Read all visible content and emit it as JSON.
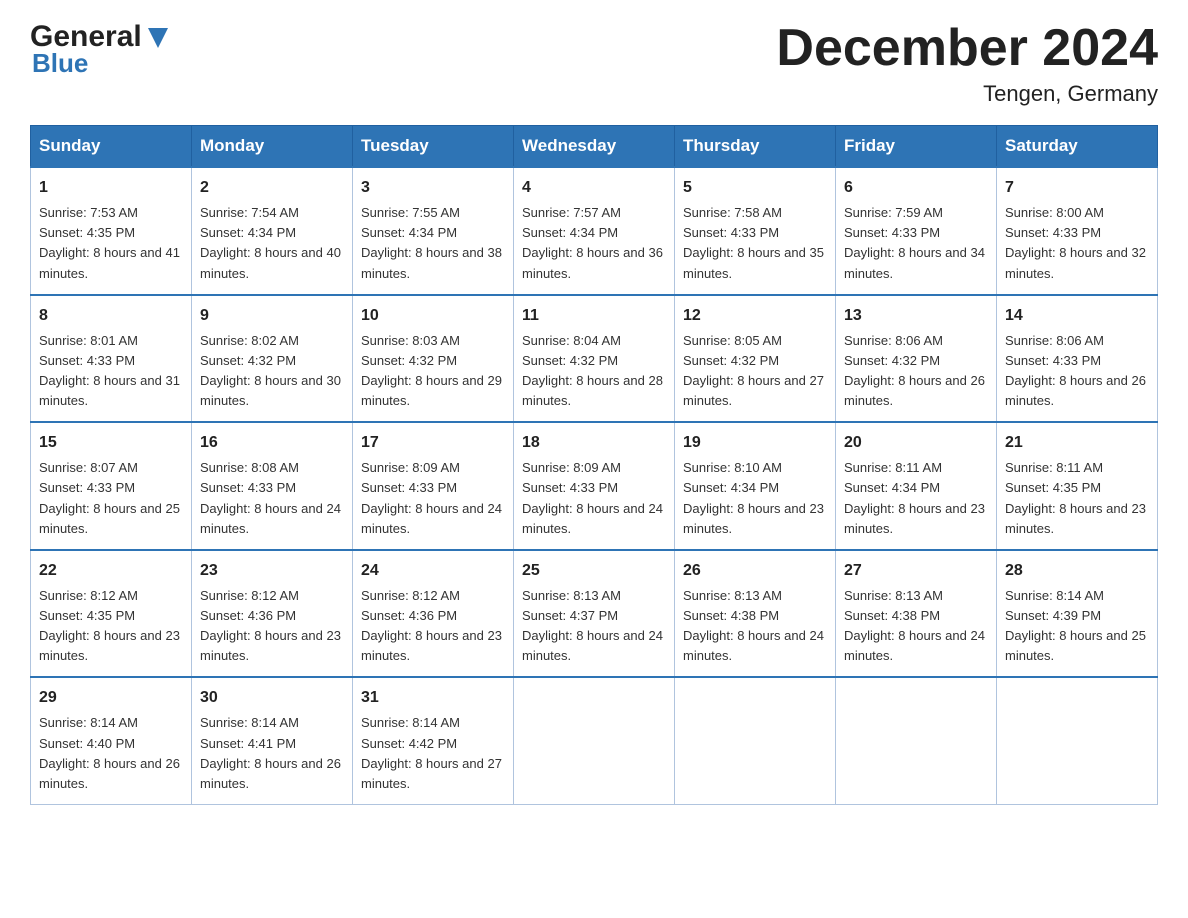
{
  "header": {
    "logo_general": "General",
    "logo_blue": "Blue",
    "title": "December 2024",
    "location": "Tengen, Germany"
  },
  "days_of_week": [
    "Sunday",
    "Monday",
    "Tuesday",
    "Wednesday",
    "Thursday",
    "Friday",
    "Saturday"
  ],
  "weeks": [
    [
      {
        "day": "1",
        "sunrise": "7:53 AM",
        "sunset": "4:35 PM",
        "daylight": "8 hours and 41 minutes."
      },
      {
        "day": "2",
        "sunrise": "7:54 AM",
        "sunset": "4:34 PM",
        "daylight": "8 hours and 40 minutes."
      },
      {
        "day": "3",
        "sunrise": "7:55 AM",
        "sunset": "4:34 PM",
        "daylight": "8 hours and 38 minutes."
      },
      {
        "day": "4",
        "sunrise": "7:57 AM",
        "sunset": "4:34 PM",
        "daylight": "8 hours and 36 minutes."
      },
      {
        "day": "5",
        "sunrise": "7:58 AM",
        "sunset": "4:33 PM",
        "daylight": "8 hours and 35 minutes."
      },
      {
        "day": "6",
        "sunrise": "7:59 AM",
        "sunset": "4:33 PM",
        "daylight": "8 hours and 34 minutes."
      },
      {
        "day": "7",
        "sunrise": "8:00 AM",
        "sunset": "4:33 PM",
        "daylight": "8 hours and 32 minutes."
      }
    ],
    [
      {
        "day": "8",
        "sunrise": "8:01 AM",
        "sunset": "4:33 PM",
        "daylight": "8 hours and 31 minutes."
      },
      {
        "day": "9",
        "sunrise": "8:02 AM",
        "sunset": "4:32 PM",
        "daylight": "8 hours and 30 minutes."
      },
      {
        "day": "10",
        "sunrise": "8:03 AM",
        "sunset": "4:32 PM",
        "daylight": "8 hours and 29 minutes."
      },
      {
        "day": "11",
        "sunrise": "8:04 AM",
        "sunset": "4:32 PM",
        "daylight": "8 hours and 28 minutes."
      },
      {
        "day": "12",
        "sunrise": "8:05 AM",
        "sunset": "4:32 PM",
        "daylight": "8 hours and 27 minutes."
      },
      {
        "day": "13",
        "sunrise": "8:06 AM",
        "sunset": "4:32 PM",
        "daylight": "8 hours and 26 minutes."
      },
      {
        "day": "14",
        "sunrise": "8:06 AM",
        "sunset": "4:33 PM",
        "daylight": "8 hours and 26 minutes."
      }
    ],
    [
      {
        "day": "15",
        "sunrise": "8:07 AM",
        "sunset": "4:33 PM",
        "daylight": "8 hours and 25 minutes."
      },
      {
        "day": "16",
        "sunrise": "8:08 AM",
        "sunset": "4:33 PM",
        "daylight": "8 hours and 24 minutes."
      },
      {
        "day": "17",
        "sunrise": "8:09 AM",
        "sunset": "4:33 PM",
        "daylight": "8 hours and 24 minutes."
      },
      {
        "day": "18",
        "sunrise": "8:09 AM",
        "sunset": "4:33 PM",
        "daylight": "8 hours and 24 minutes."
      },
      {
        "day": "19",
        "sunrise": "8:10 AM",
        "sunset": "4:34 PM",
        "daylight": "8 hours and 23 minutes."
      },
      {
        "day": "20",
        "sunrise": "8:11 AM",
        "sunset": "4:34 PM",
        "daylight": "8 hours and 23 minutes."
      },
      {
        "day": "21",
        "sunrise": "8:11 AM",
        "sunset": "4:35 PM",
        "daylight": "8 hours and 23 minutes."
      }
    ],
    [
      {
        "day": "22",
        "sunrise": "8:12 AM",
        "sunset": "4:35 PM",
        "daylight": "8 hours and 23 minutes."
      },
      {
        "day": "23",
        "sunrise": "8:12 AM",
        "sunset": "4:36 PM",
        "daylight": "8 hours and 23 minutes."
      },
      {
        "day": "24",
        "sunrise": "8:12 AM",
        "sunset": "4:36 PM",
        "daylight": "8 hours and 23 minutes."
      },
      {
        "day": "25",
        "sunrise": "8:13 AM",
        "sunset": "4:37 PM",
        "daylight": "8 hours and 24 minutes."
      },
      {
        "day": "26",
        "sunrise": "8:13 AM",
        "sunset": "4:38 PM",
        "daylight": "8 hours and 24 minutes."
      },
      {
        "day": "27",
        "sunrise": "8:13 AM",
        "sunset": "4:38 PM",
        "daylight": "8 hours and 24 minutes."
      },
      {
        "day": "28",
        "sunrise": "8:14 AM",
        "sunset": "4:39 PM",
        "daylight": "8 hours and 25 minutes."
      }
    ],
    [
      {
        "day": "29",
        "sunrise": "8:14 AM",
        "sunset": "4:40 PM",
        "daylight": "8 hours and 26 minutes."
      },
      {
        "day": "30",
        "sunrise": "8:14 AM",
        "sunset": "4:41 PM",
        "daylight": "8 hours and 26 minutes."
      },
      {
        "day": "31",
        "sunrise": "8:14 AM",
        "sunset": "4:42 PM",
        "daylight": "8 hours and 27 minutes."
      },
      null,
      null,
      null,
      null
    ]
  ],
  "cell_labels": {
    "sunrise": "Sunrise: ",
    "sunset": "Sunset: ",
    "daylight": "Daylight: "
  }
}
